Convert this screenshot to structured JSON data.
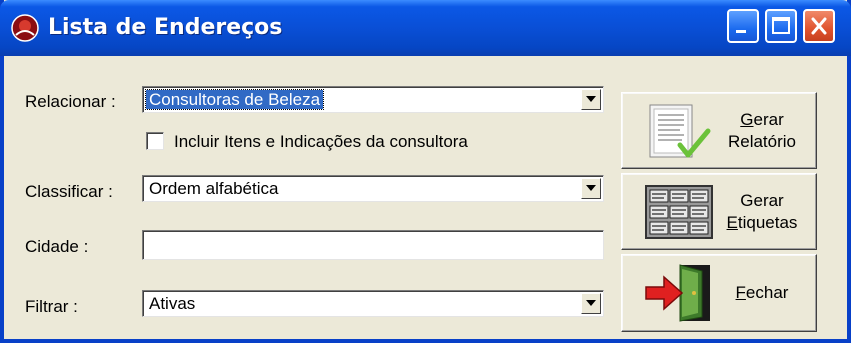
{
  "window": {
    "title": "Lista de Endereços"
  },
  "form": {
    "relacionar": {
      "label": "Relacionar :",
      "value": "Consultoras de Beleza"
    },
    "incluir": {
      "label": "Incluir Itens e Indicações da consultora",
      "checked": false
    },
    "classificar": {
      "label": "Classificar :",
      "value": "Ordem alfabética"
    },
    "cidade": {
      "label": "Cidade :",
      "value": ""
    },
    "filtrar": {
      "label": "Filtrar :",
      "value": "Ativas"
    }
  },
  "buttons": {
    "gerar_relatorio": {
      "line1_key": "G",
      "line1_rest": "erar",
      "line2": "Relatório"
    },
    "gerar_etiquetas": {
      "line1": "Gerar",
      "line2_key": "E",
      "line2_rest": "tiquetas"
    },
    "fechar": {
      "key": "F",
      "rest": "echar"
    }
  },
  "colors": {
    "titlebar": "#0a4fd6",
    "selection": "#316ac5",
    "face": "#ece9d8"
  }
}
